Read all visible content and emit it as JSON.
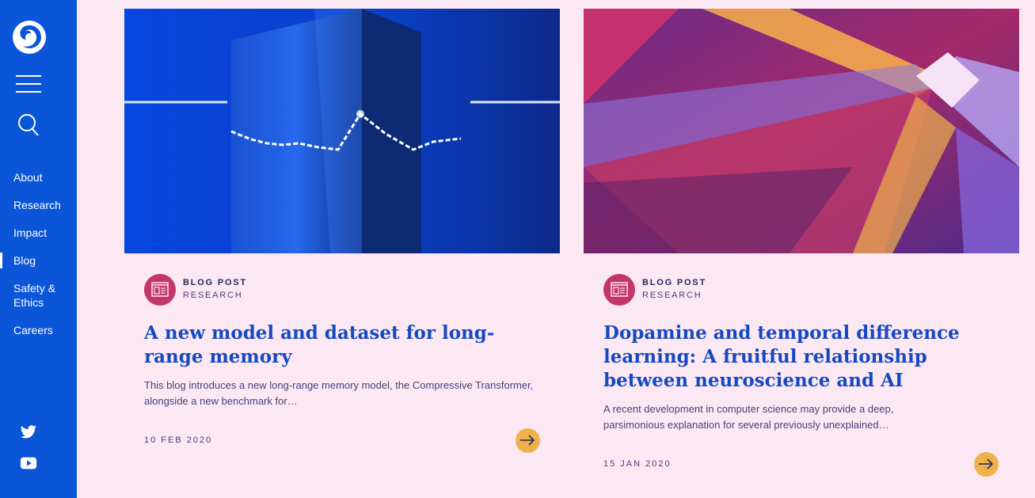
{
  "sidebar": {
    "nav": [
      {
        "label": "About",
        "active": false
      },
      {
        "label": "Research",
        "active": false
      },
      {
        "label": "Impact",
        "active": false
      },
      {
        "label": "Blog",
        "active": true
      },
      {
        "label": "Safety & Ethics",
        "active": false
      },
      {
        "label": "Careers",
        "active": false
      }
    ],
    "social": [
      "twitter-icon",
      "youtube-icon"
    ]
  },
  "cards": [
    {
      "type": "BLOG POST",
      "category": "RESEARCH",
      "title": "A new model and dataset for long-range memory",
      "excerpt": "This blog introduces a new long-range memory model, the Compressive Transformer, alongside a new benchmark for…",
      "date": "10 FEB 2020"
    },
    {
      "type": "BLOG POST",
      "category": "RESEARCH",
      "title": "Dopamine and temporal difference learning: A fruitful relationship between neuroscience and AI",
      "excerpt": "A recent development in computer science may provide a deep, parsimonious explanation for several previously unexplained…",
      "date": "15 JAN 2020"
    }
  ],
  "colors": {
    "sidebar": "#0a55d8",
    "background": "#fbe8f3",
    "title": "#1549c2",
    "badge": "#c4356b",
    "arrow": "#f0b04c"
  }
}
